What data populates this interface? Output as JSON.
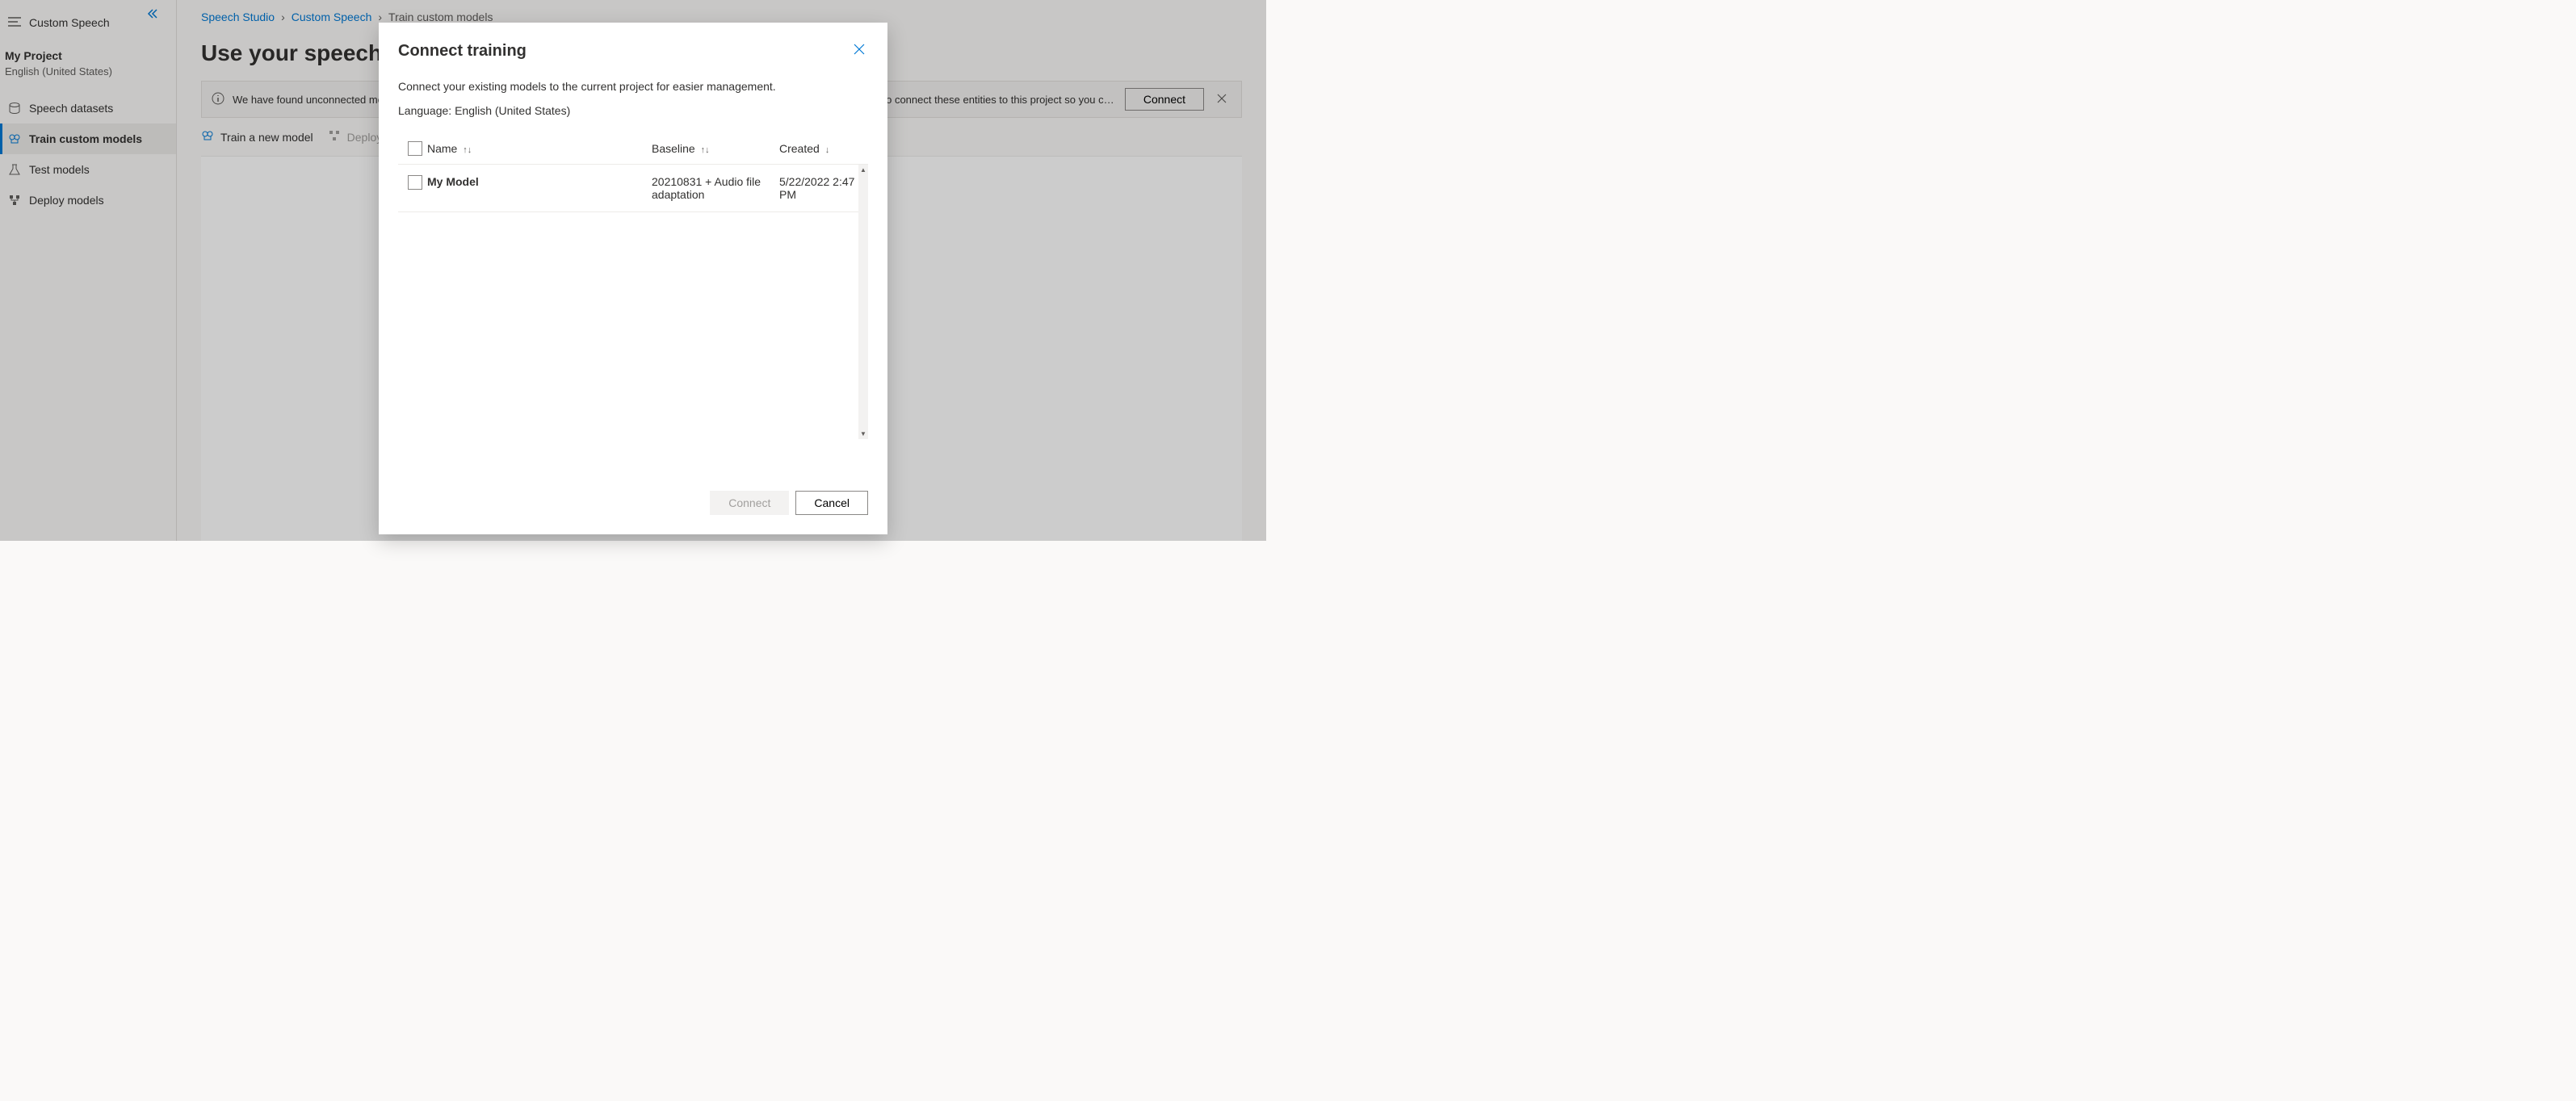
{
  "sidebar": {
    "header": "Custom Speech",
    "project_name": "My Project",
    "project_language": "English (United States)",
    "nav": [
      {
        "label": "Speech datasets"
      },
      {
        "label": "Train custom models"
      },
      {
        "label": "Test models"
      },
      {
        "label": "Deploy models"
      }
    ]
  },
  "breadcrumb": {
    "root": "Speech Studio",
    "mid": "Custom Speech",
    "leaf": "Train custom models"
  },
  "page": {
    "title": "Use your speech data"
  },
  "banner": {
    "text_start": "We have found unconnected models",
    "text_end": "want to connect these entities to this project so you can ...",
    "connect_label": "Connect"
  },
  "toolbar": {
    "train_label": "Train a new model",
    "deploy_label": "Deploy"
  },
  "modal": {
    "title": "Connect training",
    "description": "Connect your existing models to the current project for easier management.",
    "language_label": "Language: English (United States)",
    "columns": {
      "name": "Name",
      "baseline": "Baseline",
      "created": "Created"
    },
    "rows": [
      {
        "name": "My Model",
        "baseline": "20210831 + Audio file adaptation",
        "created": "5/22/2022 2:47 PM"
      }
    ],
    "connect_button": "Connect",
    "cancel_button": "Cancel"
  }
}
